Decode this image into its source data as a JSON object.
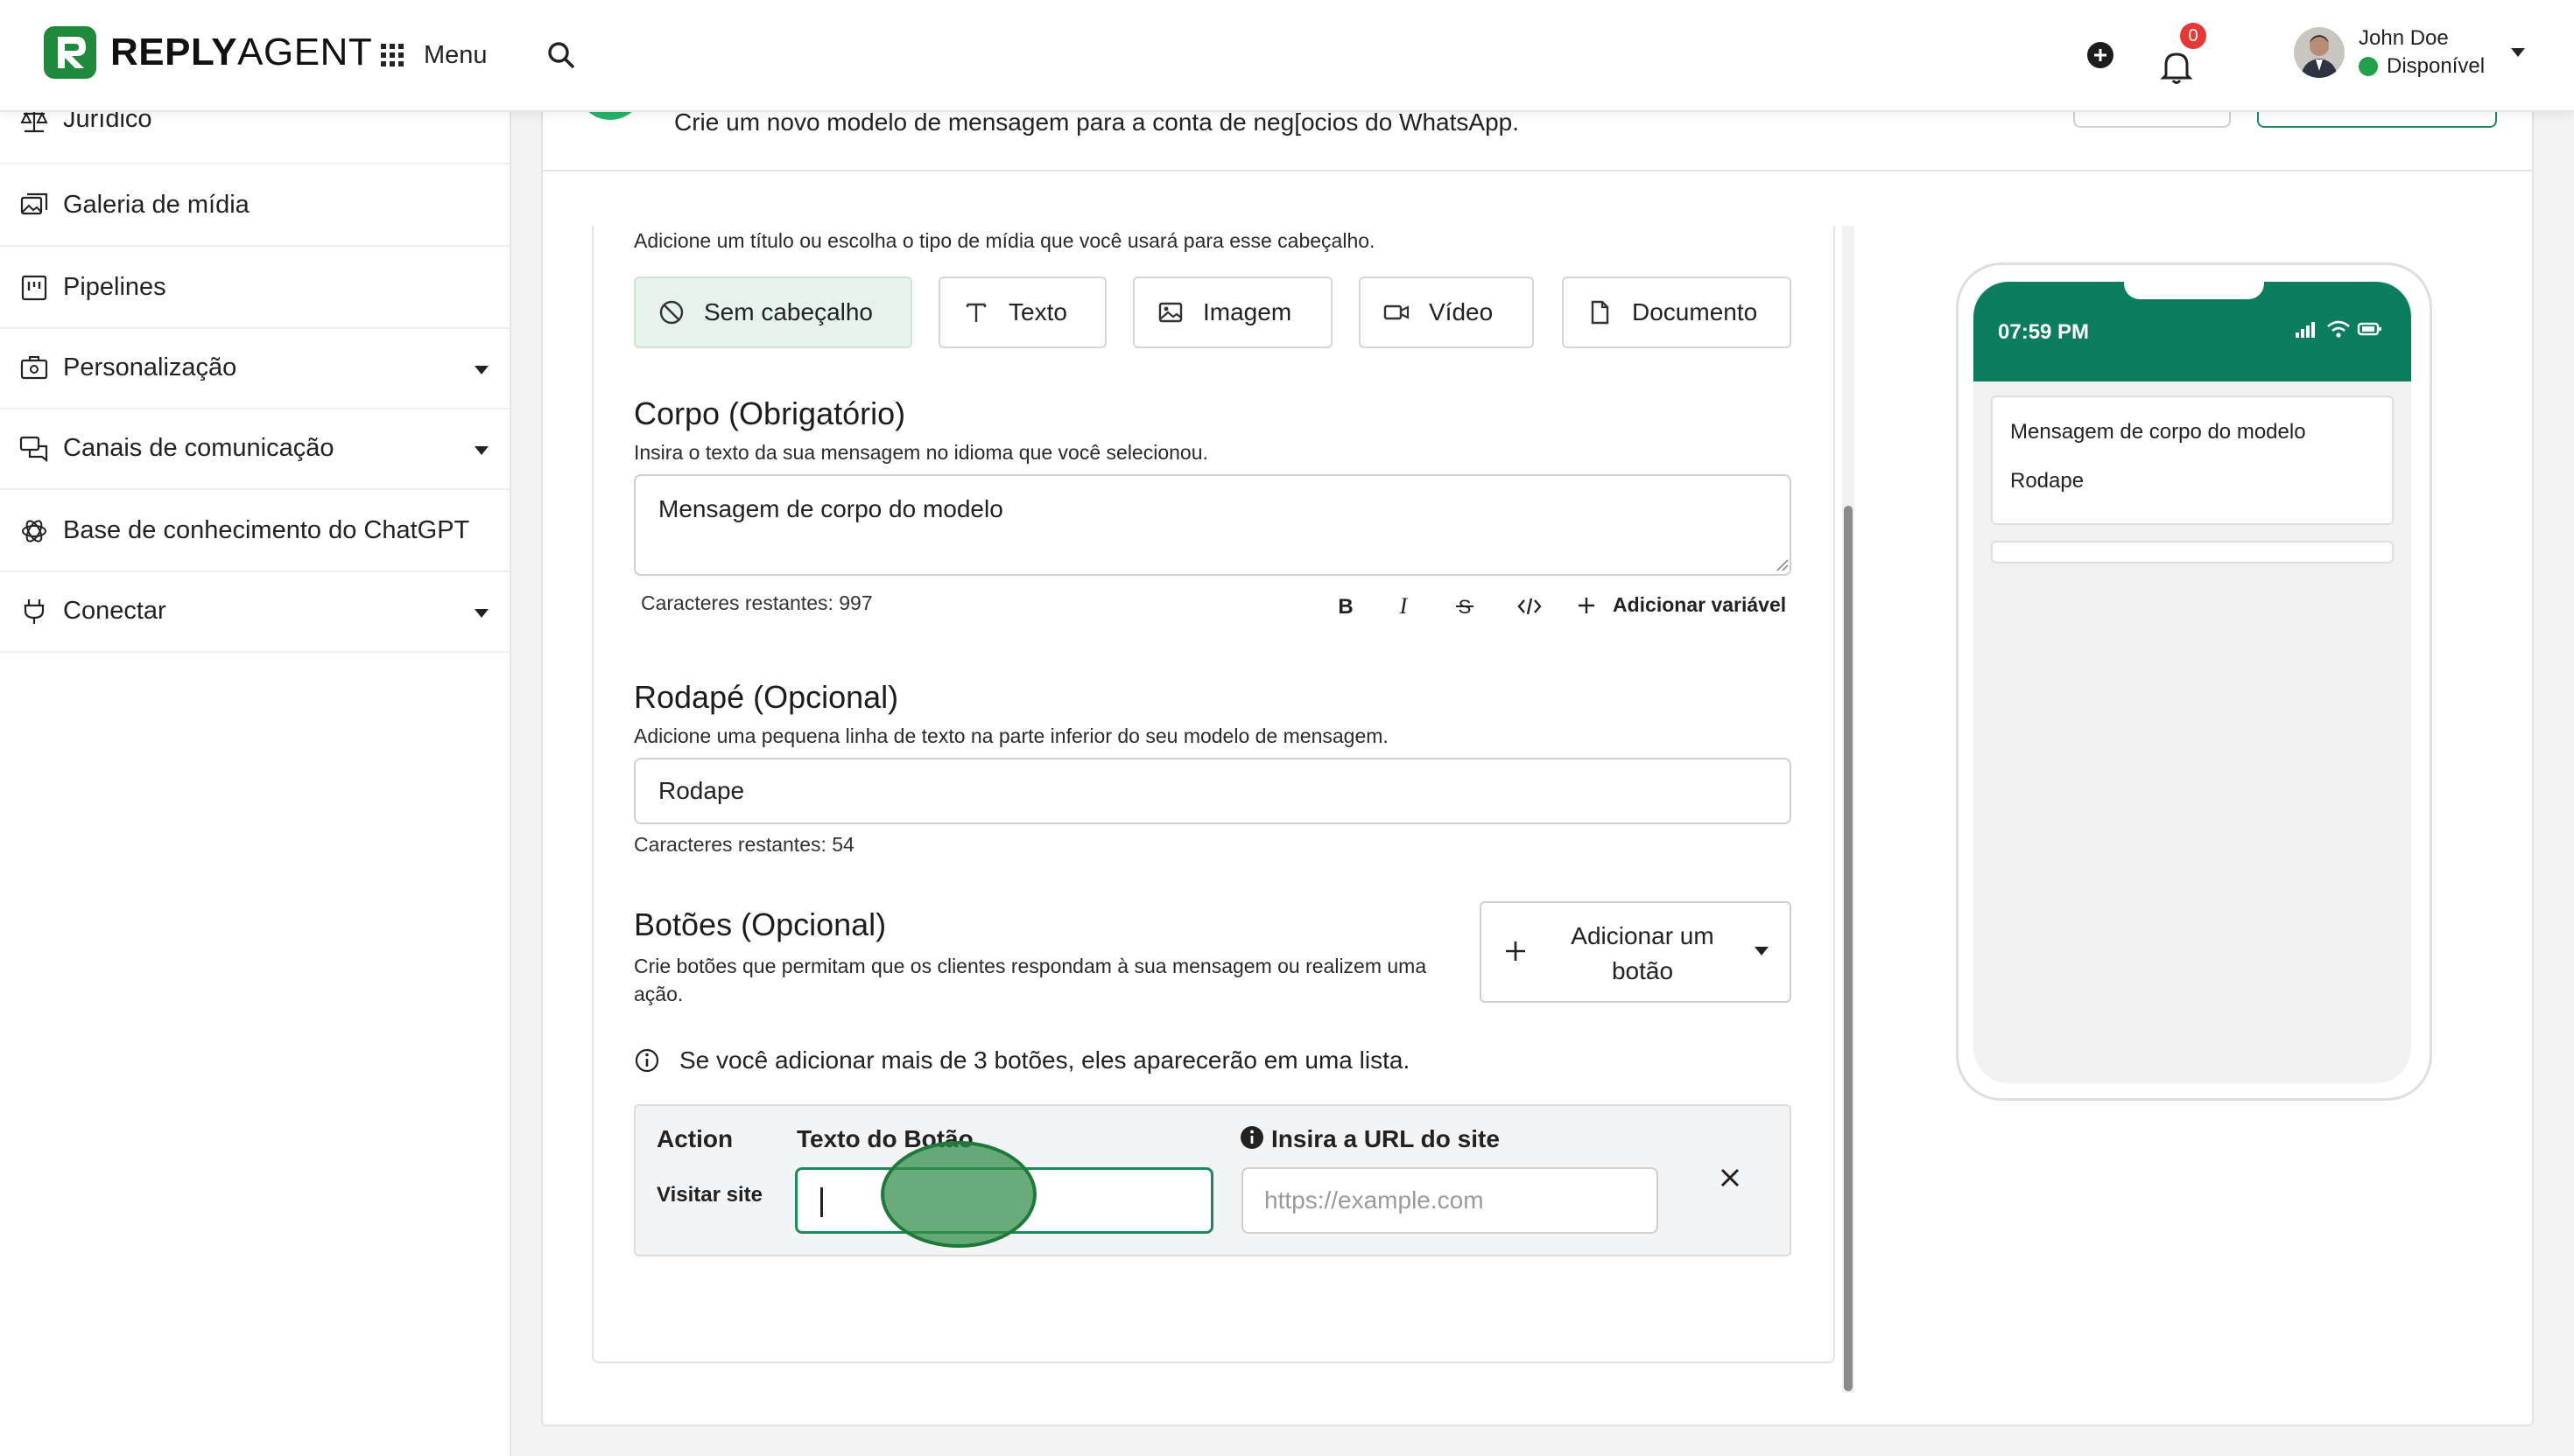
{
  "header": {
    "logo_bold": "REPLY",
    "logo_light": "AGENT",
    "menu_label": "Menu",
    "notification_count": "0",
    "user_name": "John Doe",
    "user_status": "Disponível",
    "status_color": "#22a04b"
  },
  "sidebar": {
    "items": [
      {
        "label": "Jurídico",
        "icon": "scale-icon"
      },
      {
        "label": "Galeria de mídia",
        "icon": "media-gallery-icon"
      },
      {
        "label": "Pipelines",
        "icon": "pipeline-icon"
      },
      {
        "label": "Personalização",
        "icon": "personalization-icon",
        "expandable": true
      },
      {
        "label": "Canais de comunicação",
        "icon": "chat-channels-icon",
        "expandable": true
      },
      {
        "label": "Base de conhecimento do ChatGPT",
        "icon": "openai-icon"
      },
      {
        "label": "Conectar",
        "icon": "plug-icon",
        "expandable": true
      }
    ]
  },
  "page": {
    "subtitle": "Crie um novo modelo de mensagem para a conta de neg[ocios do WhatsApp."
  },
  "form": {
    "header_hint": "Adicione um título ou escolha o tipo de mídia que você usará para esse cabeçalho.",
    "header_types": [
      {
        "label": "Sem cabeçalho",
        "icon": "ban-icon",
        "selected": true
      },
      {
        "label": "Texto",
        "icon": "text-icon",
        "selected": false
      },
      {
        "label": "Imagem",
        "icon": "image-icon",
        "selected": false
      },
      {
        "label": "Vídeo",
        "icon": "video-icon",
        "selected": false
      },
      {
        "label": "Documento",
        "icon": "document-icon",
        "selected": false
      }
    ],
    "body": {
      "title": "Corpo (Obrigatório)",
      "hint": "Insira o texto da sua mensagem no idioma que você selecionou.",
      "value": "Mensagem de corpo do modelo",
      "chars_remaining": "Caracteres restantes: 997",
      "add_variable": "Adicionar variável"
    },
    "footer": {
      "title": "Rodapé (Opcional)",
      "hint": "Adicione uma pequena linha de texto na parte inferior do seu modelo de mensagem.",
      "value": "Rodape",
      "chars_remaining": "Caracteres restantes: 54"
    },
    "buttons": {
      "title": "Botões (Opcional)",
      "hint": "Crie botões que permitam que os clientes respondam à sua mensagem ou realizem uma ação.",
      "add_button": "Adicionar um botão",
      "info": "Se você adicionar mais de 3 botões, eles aparecerão em uma lista.",
      "col_action": "Action",
      "col_text": "Texto do Botão",
      "col_url": "Insira a URL do site",
      "action_value": "Visitar site",
      "text_value": "",
      "url_placeholder": "https://example.com"
    }
  },
  "preview": {
    "time": "07:59 PM",
    "body": "Mensagem de corpo do modelo",
    "footer": "Rodape",
    "bar_color": "#0d7d60"
  },
  "accent_color": "#1e8a5c"
}
